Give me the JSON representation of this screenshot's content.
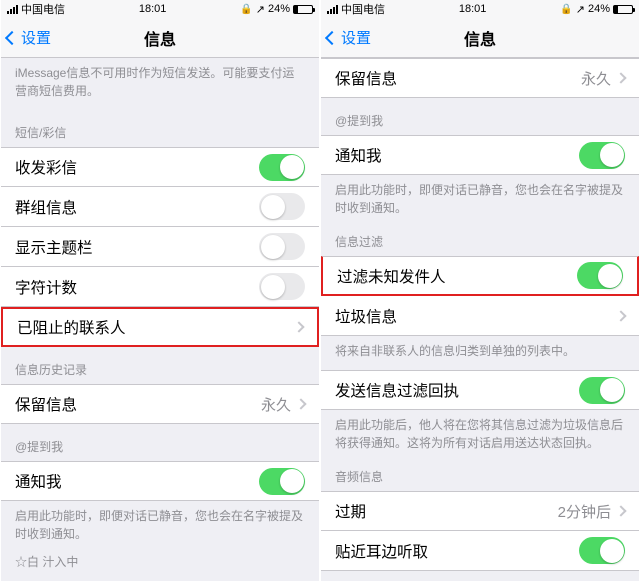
{
  "status": {
    "carrier": "中国电信",
    "time": "18:01",
    "lock": "🔒",
    "orient": "↗",
    "battery": "24%"
  },
  "nav": {
    "back": "设置",
    "title": "信息"
  },
  "left": {
    "topNote": "iMessage信息不可用时作为短信发送。可能要支付运营商短信费用。",
    "sec1": "短信/彩信",
    "r1": "收发彩信",
    "r2": "群组信息",
    "r3": "显示主题栏",
    "r4": "字符计数",
    "r5": "已阻止的联系人",
    "sec2": "信息历史记录",
    "r6": "保留信息",
    "r6v": "永久",
    "sec3": "@提到我",
    "r7": "通知我",
    "note7": "启用此功能时，即便对话已静音，您也会在名字被提及时收到通知。",
    "foot": "☆白 汁入中"
  },
  "right": {
    "r1": "保留信息",
    "r1v": "永久",
    "sec1": "@提到我",
    "r2": "通知我",
    "note2": "启用此功能时，即便对话已静音，您也会在名字被提及时收到通知。",
    "sec2": "信息过滤",
    "r3": "过滤未知发件人",
    "r4": "垃圾信息",
    "note4": "将来自非联系人的信息归类到单独的列表中。",
    "r5": "发送信息过滤回执",
    "note5": "启用此功能后，他人将在您将其信息过滤为垃圾信息后将获得通知。这将为所有对话启用送达状态回执。",
    "sec3": "音频信息",
    "r6": "过期",
    "r6v": "2分钟后",
    "r7": "贴近耳边听取"
  }
}
